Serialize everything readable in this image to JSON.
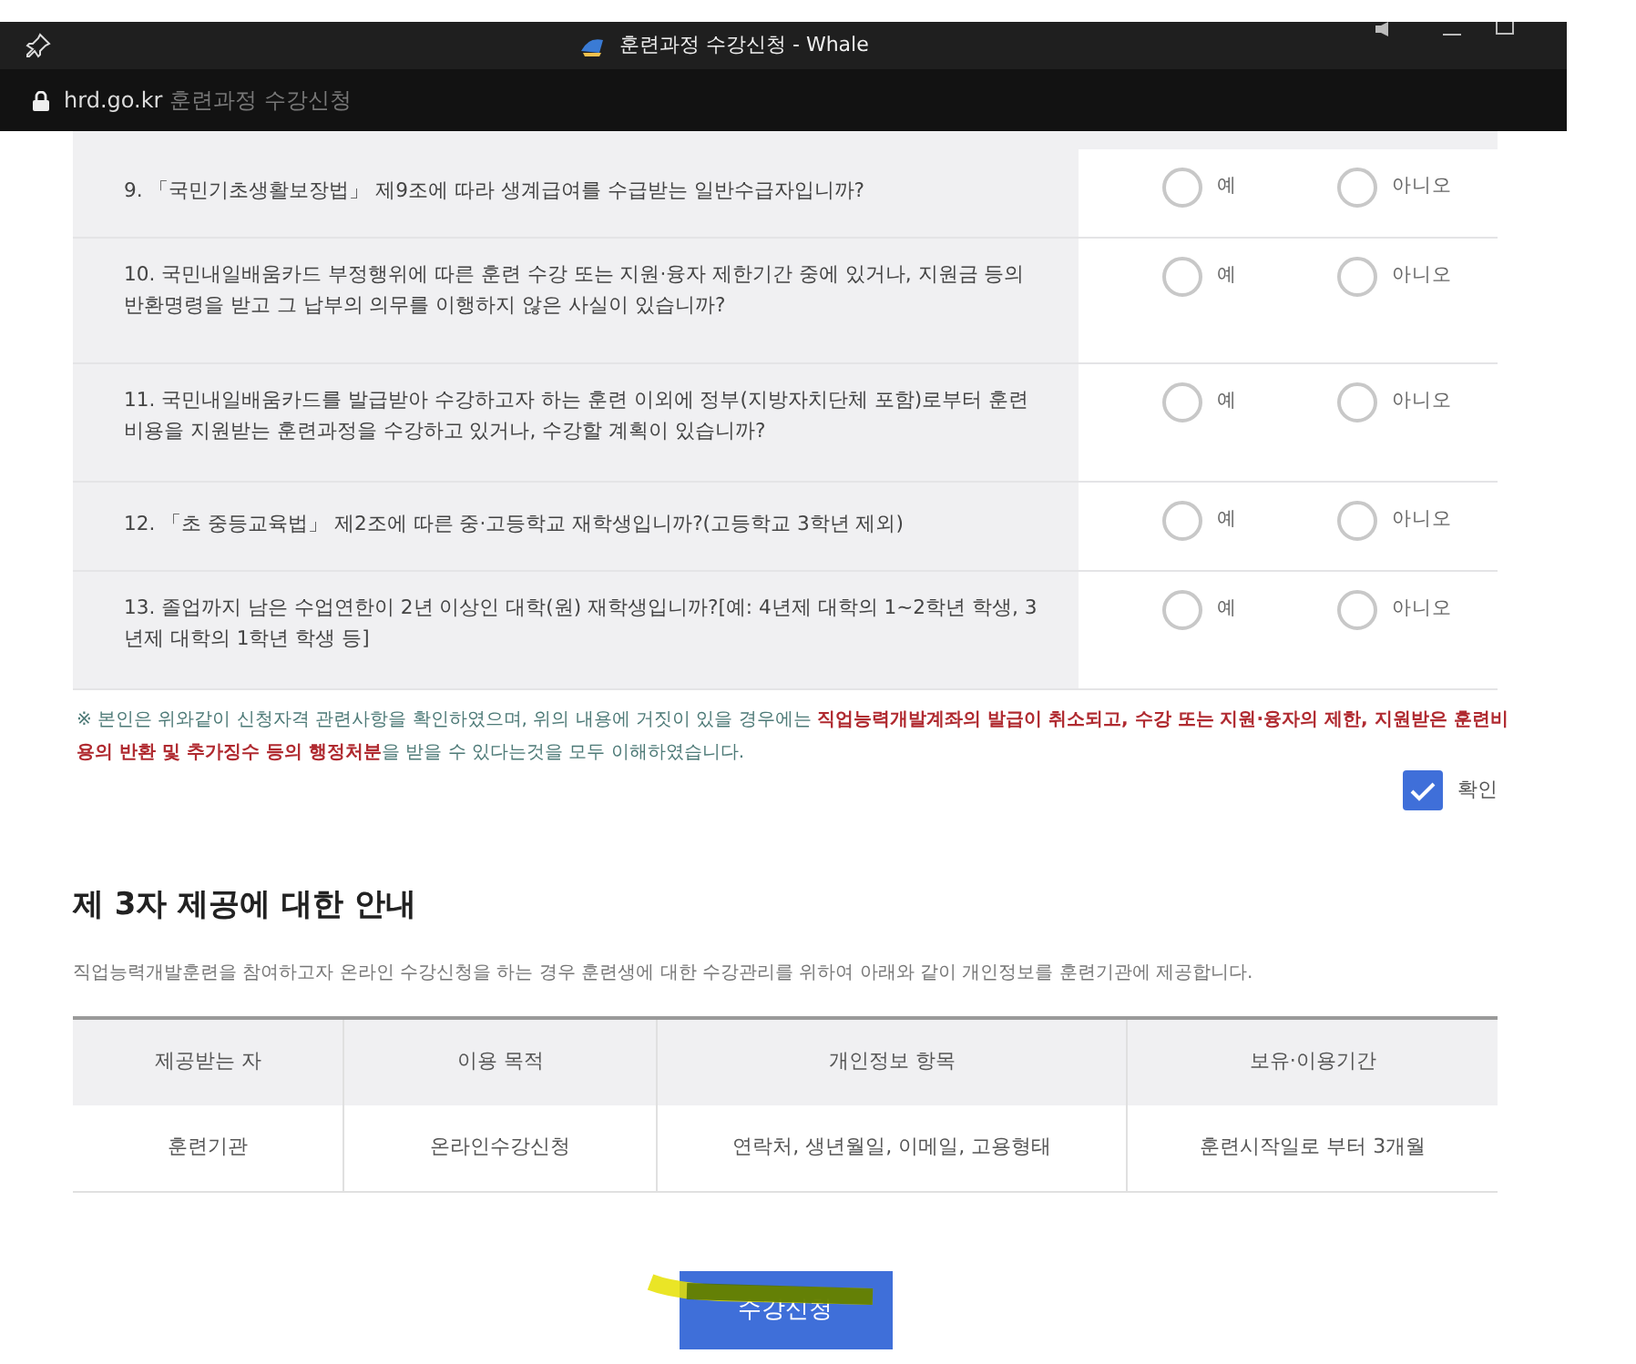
{
  "browser": {
    "title": "훈련과정 수강신청 - Whale",
    "url_host": "hrd.go.kr",
    "url_title": "훈련과정 수강신청"
  },
  "questions": [
    {
      "text": "9. 「국민기초생활보장법」 제9조에 따라 생계급여를 수급받는 일반수급자입니까?",
      "options": [
        {
          "label": "예",
          "selected": false
        },
        {
          "label": "아니오",
          "selected": false
        }
      ]
    },
    {
      "text": "10. 국민내일배움카드 부정행위에 따른 훈련 수강 또는 지원·융자 제한기간 중에 있거나, 지원금 등의 반환명령을 받고 그 납부의 의무를 이행하지 않은 사실이 있습니까?",
      "options": [
        {
          "label": "예",
          "selected": false
        },
        {
          "label": "아니오",
          "selected": false
        }
      ]
    },
    {
      "text": "11. 국민내일배움카드를 발급받아 수강하고자 하는 훈련 이외에 정부(지방자치단체 포함)로부터 훈련비용을 지원받는 훈련과정을 수강하고 있거나, 수강할 계획이 있습니까?",
      "options": [
        {
          "label": "예",
          "selected": false
        },
        {
          "label": "아니오",
          "selected": false
        }
      ]
    },
    {
      "text": "12. 「초 중등교육법」 제2조에 따른 중·고등학교 재학생입니까?(고등학교 3학년 제외)",
      "options": [
        {
          "label": "예",
          "selected": false
        },
        {
          "label": "아니오",
          "selected": false
        }
      ]
    },
    {
      "text": "13. 졸업까지 남은 수업연한이 2년 이상인 대학(원) 재학생입니까?[예: 4년제 대학의 1~2학년 학생, 3년제 대학의 1학년 학생 등]",
      "options": [
        {
          "label": "예",
          "selected": false
        },
        {
          "label": "아니오",
          "selected": false
        }
      ]
    }
  ],
  "notice": "※ 본인은 위와같이 신청자격 관련사항을 확인하였으며, 위의 내용에 거짓이 있을 경우에는 **직업능력개발계좌의 발급이 취소되고, 수강 또는 지원·융자의 제한, 지원받은 훈련비용의 반환 및 추가징수 등의 행정처분**을 받을 수 있다는것을 모두 이해하였습니다.",
  "confirm": {
    "label": "확인",
    "checked": true
  },
  "third_party": {
    "heading": "제 3자 제공에 대한 안내",
    "description": "직업능력개발훈련을 참여하고자 온라인 수강신청을 하는 경우 훈련생에 대한 수강관리를 위하여 아래와 같이 개인정보를 훈련기관에 제공합니다.",
    "table": {
      "columns": [
        "제공받는 자",
        "이용 목적",
        "개인정보 항목",
        "보유·이용기간"
      ],
      "rows": [
        [
          "훈련기관",
          "온라인수강신청",
          "연락처, 생년월일, 이메일, 고용형태",
          "훈련시작일로 부터 3개월"
        ]
      ]
    }
  },
  "submit_button": "수강신청"
}
